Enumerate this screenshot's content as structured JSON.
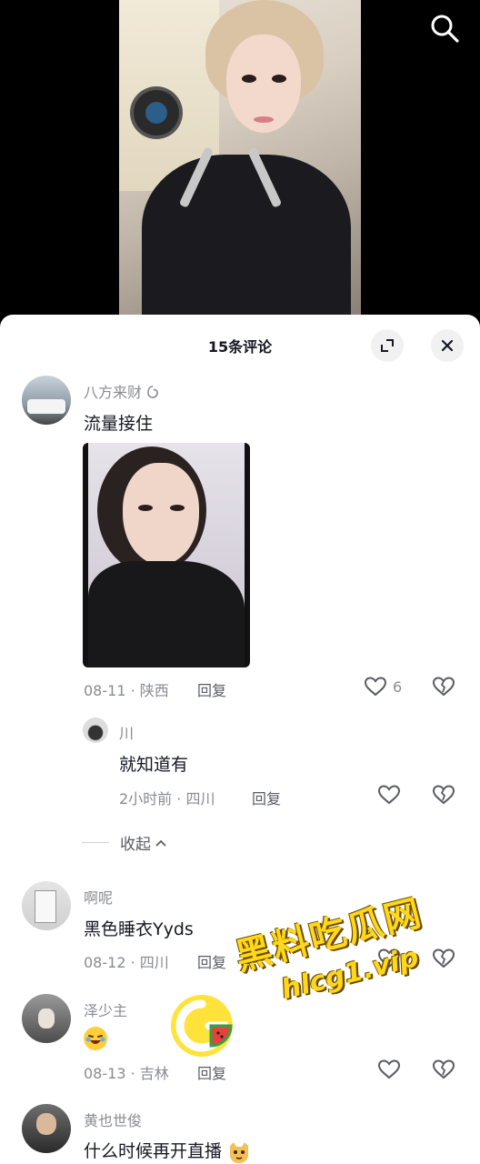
{
  "sheet": {
    "title": "15条评论",
    "expand_icon": "expand-icon",
    "close_icon": "close-icon"
  },
  "comments": [
    {
      "user": "八方来财",
      "text": "流量接住",
      "date_location": "08-11 · 陕西",
      "reply_label": "回复",
      "likes": "6",
      "has_image": true
    },
    {
      "user": "川",
      "text": "就知道有",
      "date_location": "2小时前 · 四川",
      "reply_label": "回复",
      "is_reply": true
    },
    {
      "user": "啊呢",
      "text": "黑色睡衣Yyds",
      "date_location": "08-12 · 四川",
      "reply_label": "回复"
    },
    {
      "user": "泽少主",
      "text": "",
      "emoji": "laughing-emoji",
      "date_location": "08-13 · 吉林",
      "reply_label": "回复"
    },
    {
      "user": "黄也世俊",
      "text": "什么时候再开直播",
      "emoji": "cat-emoji"
    }
  ],
  "collapse_label": "收起",
  "watermark": {
    "title": "黑料吃瓜网",
    "url": "hlcg1.vip"
  },
  "colors": {
    "sheet_bg": "#ffffff",
    "text_primary": "#161823",
    "text_secondary": "#8a8b91",
    "watermark": "#ffd81a"
  }
}
